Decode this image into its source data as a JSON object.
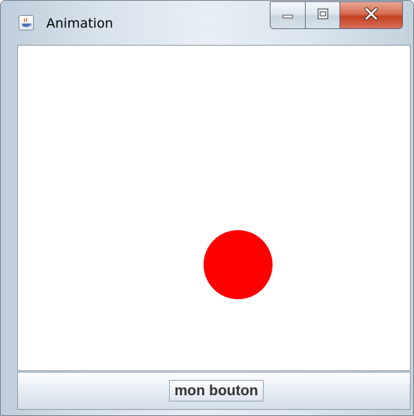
{
  "window": {
    "title": "Animation",
    "icon": "java-app-icon"
  },
  "caption_buttons": {
    "minimize_icon": "minimize-icon",
    "maximize_icon": "maximize-icon",
    "close_icon": "close-icon"
  },
  "canvas": {
    "ball_color": "#ff0000"
  },
  "bottom_panel": {
    "button_label": "mon bouton"
  }
}
